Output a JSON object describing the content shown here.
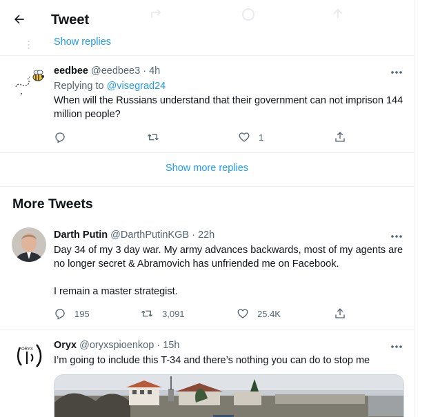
{
  "header": {
    "title": "Tweet",
    "back_icon": "arrow-left-icon"
  },
  "thread": {
    "show_replies": "Show replies"
  },
  "reply_tweet": {
    "name": "eedbee",
    "handle": "@eedbee3",
    "separator": "·",
    "time": "4h",
    "replying_prefix": "Replying to",
    "replying_to": "@visegrad24",
    "text": "When will the Russians understand that their government can not imprison 144 million people?",
    "actions": {
      "reply_count": "",
      "retweet_count": "",
      "like_count": "1"
    }
  },
  "show_more_replies": "Show more replies",
  "more_tweets": {
    "title": "More Tweets",
    "tweets": [
      {
        "name": "Darth Putin",
        "handle": "@DarthPutinKGB",
        "separator": "·",
        "time": "22h",
        "text_line1": "Day 34 of my 3 day war. My army advances backwards, most of my agents are no longer secret & Abramovich has unfriended me on Facebook.",
        "text_line2": "I remain a master strategist.",
        "actions": {
          "reply_count": "195",
          "retweet_count": "3,091",
          "like_count": "25.4K"
        }
      },
      {
        "name": "Oryx",
        "handle": "@oryxspioenkop",
        "separator": "·",
        "time": "15h",
        "avatar_text": "ORYX",
        "text": "I’m going to include this T-34 and there’s nothing you can do to stop me"
      }
    ]
  },
  "colors": {
    "accent": "#1d9bf0",
    "text_primary": "#0f1419",
    "text_secondary": "#536471",
    "border": "#eff3f4"
  }
}
